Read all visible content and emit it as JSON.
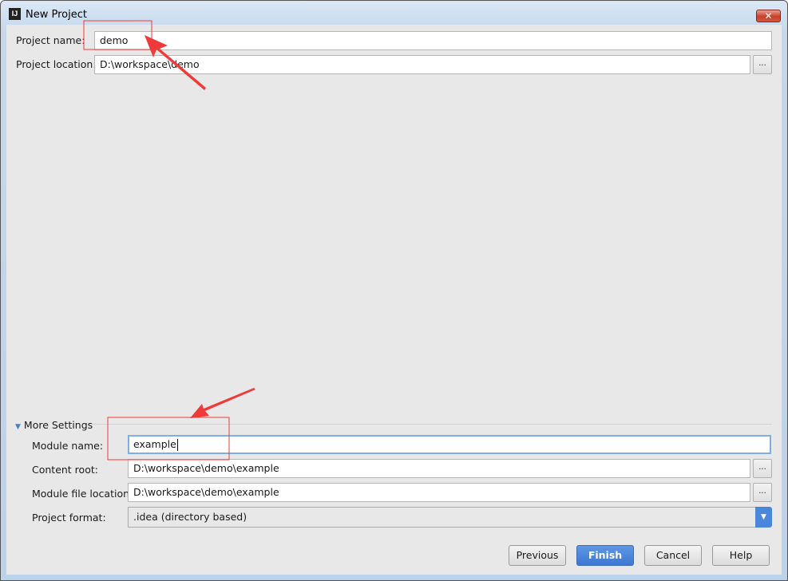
{
  "window": {
    "title": "New Project",
    "icon_text": "IJ",
    "close_glyph": "✕"
  },
  "form": {
    "project_name": {
      "label": "Project name:",
      "value": "demo"
    },
    "project_location": {
      "label": "Project location:",
      "value": "D:\\workspace\\demo",
      "browse": "..."
    }
  },
  "more_settings": {
    "label": "More Settings",
    "module_name": {
      "label": "Module name:",
      "value": "example"
    },
    "content_root": {
      "label": "Content root:",
      "value": "D:\\workspace\\demo\\example",
      "browse": "..."
    },
    "module_file_location": {
      "label": "Module file location:",
      "value": "D:\\workspace\\demo\\example",
      "browse": "..."
    },
    "project_format": {
      "label": "Project format:",
      "value": ".idea (directory based)"
    }
  },
  "buttons": {
    "previous": "Previous",
    "finish": "Finish",
    "cancel": "Cancel",
    "help": "Help"
  },
  "colors": {
    "accent": "#4a86d9",
    "annotation": "#f03a3a"
  }
}
